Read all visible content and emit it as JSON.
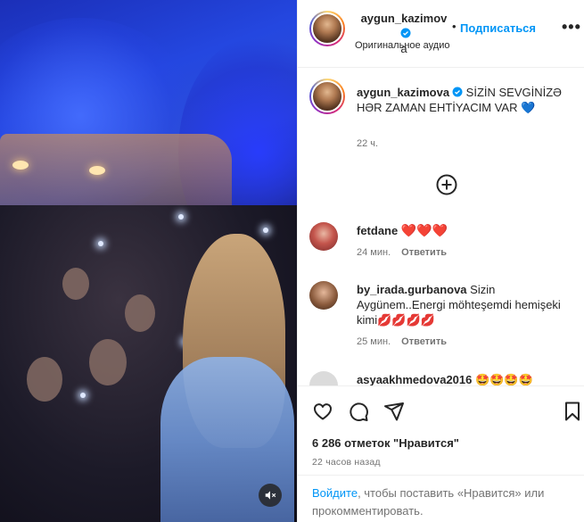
{
  "post": {
    "author": "aygun_kazimova",
    "author_line1": "aygun_kazimov",
    "author_line2": "a",
    "follow_label": "Подписаться",
    "audio": "Оригинальное аудио",
    "more_label": "•••"
  },
  "caption": {
    "username": "aygun_kazimova",
    "text": "SİZİN SEVGİNİZƏ HƏR ZAMAN EHTİYACIM VAR",
    "emoji": "💙",
    "time": "22 ч."
  },
  "comments": [
    {
      "username": "fetdane",
      "text": "❤️❤️❤️",
      "time": "24 мин.",
      "reply": "Ответить"
    },
    {
      "username": "by_irada.gurbanova",
      "text": "Sizin Aygünem..Energi möhteşemdi hemişeki kimi💋💋💋💋",
      "time": "25 мин.",
      "reply": "Ответить"
    },
    {
      "username": "asyaakhmedova2016",
      "text": "🤩🤩🤩🤩",
      "time": "",
      "reply": ""
    }
  ],
  "stats": {
    "likes": "6 286 отметок \"Нравится\"",
    "posted": "22 часов назад"
  },
  "login": {
    "link": "Войдите",
    "rest": ", чтобы поставить «Нравится» или прокомментировать."
  },
  "colors": {
    "accent": "#0095f6",
    "text": "#262626",
    "muted": "#737373",
    "media_blue": "#2447e0"
  },
  "icons": [
    "verified-badge-icon",
    "more-icon",
    "load-more-icon",
    "like-icon",
    "comment-icon",
    "share-icon",
    "save-icon",
    "mute-icon"
  ]
}
